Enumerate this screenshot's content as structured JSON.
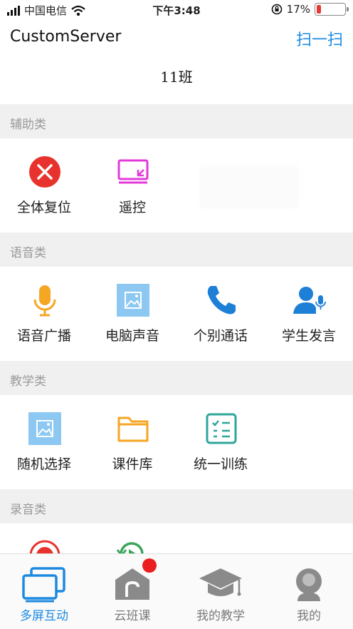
{
  "status_bar": {
    "carrier": "中国电信",
    "time": "下午3:48",
    "battery_percent": "17%",
    "battery_level": 0.17
  },
  "nav": {
    "title": "CustomServer",
    "scan_label": "扫一扫"
  },
  "class_name": "11班",
  "sections": [
    {
      "header": "辅助类",
      "items": [
        {
          "label": "全体复位",
          "icon": "reset-x-icon"
        },
        {
          "label": "遥控",
          "icon": "remote-screen-icon"
        }
      ]
    },
    {
      "header": "语音类",
      "items": [
        {
          "label": "语音广播",
          "icon": "microphone-icon"
        },
        {
          "label": "电脑声音",
          "icon": "picture-icon"
        },
        {
          "label": "个别通话",
          "icon": "phone-icon"
        },
        {
          "label": "学生发言",
          "icon": "student-speak-icon"
        }
      ]
    },
    {
      "header": "教学类",
      "items": [
        {
          "label": "随机选择",
          "icon": "picture-icon"
        },
        {
          "label": "课件库",
          "icon": "folder-icon"
        },
        {
          "label": "统一训练",
          "icon": "checklist-icon"
        }
      ]
    },
    {
      "header": "录音类",
      "items": []
    }
  ],
  "tabs": [
    {
      "label": "多屏互动",
      "icon": "multi-screen-icon",
      "active": true
    },
    {
      "label": "云班课",
      "icon": "cloud-class-icon",
      "active": false
    },
    {
      "label": "我的教学",
      "icon": "graduation-cap-icon",
      "active": false
    },
    {
      "label": "我的",
      "icon": "profile-icon",
      "active": false
    }
  ],
  "colors": {
    "accent": "#1d8ae0",
    "red": "#e8322d",
    "magenta": "#e33ad9",
    "orange": "#f5a623",
    "light_blue": "#8cc8f2",
    "teal": "#2fa59b",
    "green": "#3ba55c",
    "gray_icon": "#8a8a8a"
  }
}
